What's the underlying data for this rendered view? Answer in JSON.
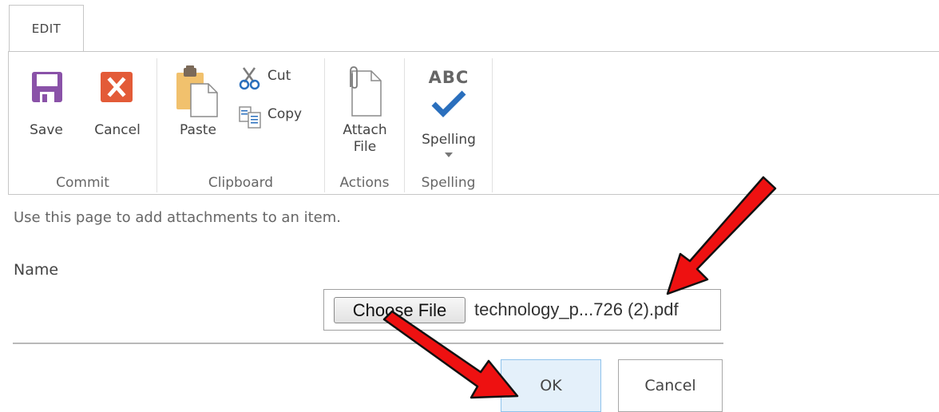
{
  "ribbon": {
    "tab_label": "EDIT",
    "groups": {
      "commit": {
        "label": "Commit",
        "save": "Save",
        "cancel": "Cancel"
      },
      "clipboard": {
        "label": "Clipboard",
        "paste": "Paste",
        "cut": "Cut",
        "copy": "Copy"
      },
      "actions": {
        "label": "Actions",
        "attach_line1": "Attach",
        "attach_line2": "File"
      },
      "spelling": {
        "label": "Spelling",
        "spelling": "Spelling",
        "abc": "ABC"
      }
    }
  },
  "form": {
    "intro": "Use this page to add attachments to an item.",
    "name_label": "Name",
    "choose_file": "Choose File",
    "file_name": "technology_p...726 (2).pdf",
    "ok": "OK",
    "cancel": "Cancel"
  },
  "colors": {
    "save_icon": "#8a52a8",
    "cancel_icon": "#e35b38",
    "checkmark": "#2a6fbd",
    "arrow": "#ee1111"
  }
}
